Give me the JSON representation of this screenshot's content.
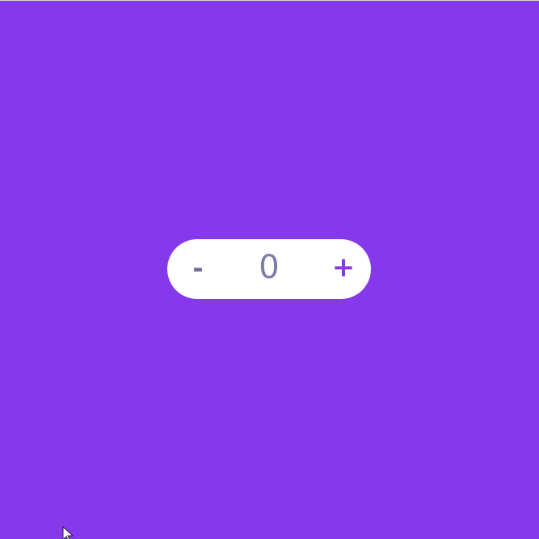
{
  "colors": {
    "background": "#8638eb",
    "counter_background": "#ffffff",
    "minus_color": "#6e6e9a",
    "plus_color": "#8638eb",
    "value_color": "#7c7ca8"
  },
  "counter": {
    "decrement_label": "-",
    "value": "0",
    "increment_label": "+"
  },
  "icons": {
    "cursor": "mouse-pointer-icon"
  }
}
